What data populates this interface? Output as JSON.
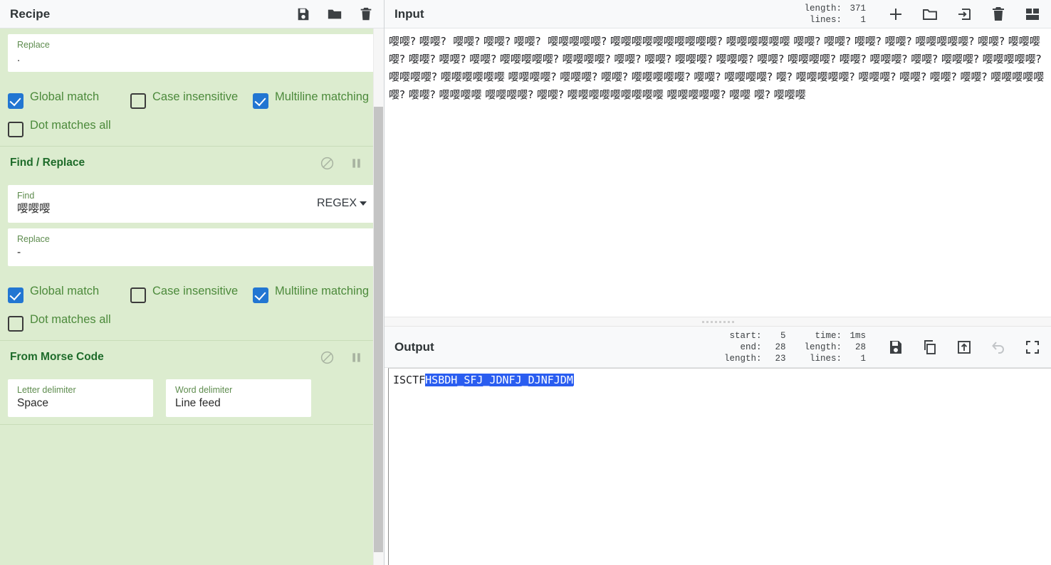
{
  "recipe": {
    "title": "Recipe",
    "header_icons": [
      {
        "name": "save-recipe-icon",
        "glyph": "save"
      },
      {
        "name": "load-recipe-icon",
        "glyph": "folder"
      },
      {
        "name": "clear-recipe-icon",
        "glyph": "trash"
      }
    ],
    "operations": [
      {
        "name": "",
        "fields": [
          {
            "label": "Replace",
            "value": "."
          }
        ],
        "checkboxes": [
          {
            "label": "Global match",
            "checked": true
          },
          {
            "label": "Case insensitive",
            "checked": false
          },
          {
            "label": "Multiline matching",
            "checked": true
          },
          {
            "label": "Dot matches all",
            "checked": false
          }
        ]
      },
      {
        "name": "Find / Replace",
        "fields": [
          {
            "label": "Find",
            "value": "嘤嘤嘤",
            "dropdown": "REGEX"
          },
          {
            "label": "Replace",
            "value": "-"
          }
        ],
        "checkboxes": [
          {
            "label": "Global match",
            "checked": true
          },
          {
            "label": "Case insensitive",
            "checked": false
          },
          {
            "label": "Multiline matching",
            "checked": true
          },
          {
            "label": "Dot matches all",
            "checked": false
          }
        ]
      },
      {
        "name": "From Morse Code",
        "fields": [
          {
            "label": "Letter delimiter",
            "value": "Space"
          },
          {
            "label": "Word delimiter",
            "value": "Line feed"
          }
        ],
        "checkboxes": []
      }
    ],
    "op_icons": [
      {
        "name": "disable-operation-icon",
        "glyph": "ban"
      },
      {
        "name": "pause-operation-icon",
        "glyph": "pause"
      }
    ]
  },
  "input": {
    "title": "Input",
    "meta": [
      {
        "key": "length:",
        "value": "371"
      },
      {
        "key": "lines:",
        "value": "1"
      }
    ],
    "icons": [
      {
        "name": "add-input-tab-icon",
        "glyph": "plus"
      },
      {
        "name": "open-file-icon",
        "glyph": "folder"
      },
      {
        "name": "open-folder-as-input-icon",
        "glyph": "import"
      },
      {
        "name": "clear-input-icon",
        "glyph": "trash"
      },
      {
        "name": "input-tabs-layout-icon",
        "glyph": "layout"
      }
    ],
    "text": "嘤嘤? 嘤嘤?  嘤嘤? 嘤嘤? 嘤嘤?  嘤嘤嘤嘤嘤? 嘤嘤嘤嘤嘤嘤嘤嘤嘤嘤? 嘤嘤嘤嘤嘤嘤 嘤嘤? 嘤嘤? 嘤嘤? 嘤嘤? 嘤嘤嘤嘤嘤? 嘤嘤? 嘤嘤嘤嘤? 嘤嘤? 嘤嘤? 嘤嘤? 嘤嘤嘤嘤嘤? 嘤嘤嘤嘤? 嘤嘤? 嘤嘤? 嘤嘤嘤? 嘤嘤嘤? 嘤嘤? 嘤嘤嘤嘤? 嘤嘤? 嘤嘤嘤? 嘤嘤? 嘤嘤嘤? 嘤嘤嘤嘤嘤? 嘤嘤嘤嘤? 嘤嘤嘤嘤嘤嘤 嘤嘤嘤嘤? 嘤嘤嘤? 嘤嘤? 嘤嘤嘤嘤嘤? 嘤嘤? 嘤嘤嘤嘤? 嘤? 嘤嘤嘤嘤嘤? 嘤嘤嘤? 嘤嘤? 嘤嘤? 嘤嘤? 嘤嘤嘤嘤嘤嘤? 嘤嘤? 嘤嘤嘤嘤 嘤嘤嘤嘤? 嘤嘤? 嘤嘤嘤嘤嘤嘤嘤嘤嘤 嘤嘤嘤嘤嘤? 嘤嘤 嘤? 嘤嘤嘤"
  },
  "output": {
    "title": "Output",
    "meta_left": [
      {
        "key": "start:",
        "value": "5"
      },
      {
        "key": "end:",
        "value": "28"
      },
      {
        "key": "length:",
        "value": "23"
      }
    ],
    "meta_right": [
      {
        "key": "time:",
        "value": "1ms"
      },
      {
        "key": "length:",
        "value": "28"
      },
      {
        "key": "lines:",
        "value": "1"
      }
    ],
    "icons": [
      {
        "name": "save-output-icon",
        "glyph": "save"
      },
      {
        "name": "copy-output-icon",
        "glyph": "copy"
      },
      {
        "name": "replace-input-with-output-icon",
        "glyph": "export"
      },
      {
        "name": "undo-icon",
        "glyph": "undo"
      },
      {
        "name": "maximise-output-icon",
        "glyph": "maximise"
      }
    ],
    "text_prefix": "ISCTF",
    "text_selected": "HSBDH_SFJ_JDNFJ_DJNFJDM"
  },
  "colors": {
    "recipe_bg": "#dceccf",
    "op_title": "#1e6b2a",
    "label": "#5e8c4e",
    "checkbox_on": "#2276d2",
    "selection": "#2a5df0",
    "header_bg": "#f8f9fa"
  }
}
